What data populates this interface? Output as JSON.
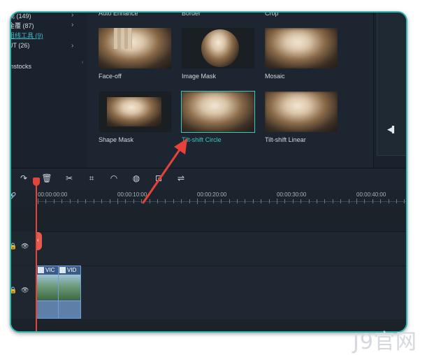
{
  "sidebar": {
    "items": [
      {
        "label": "视 (149)",
        "chevron": true
      },
      {
        "label": "金覆 (87)",
        "chevron": true
      },
      {
        "label": "组线工具 (9)",
        "chevron": false,
        "active": true
      },
      {
        "label": "UT (26)",
        "chevron": true
      },
      {
        "label": "mstocks",
        "chevron": false
      }
    ],
    "chevron_glyph": "›",
    "collapse_glyph": "‹"
  },
  "effects": {
    "top_row_labels": [
      "Auto Enhance",
      "Border",
      "Crop"
    ],
    "items": [
      {
        "label": "Face-off",
        "selected": false,
        "effect": "face-off"
      },
      {
        "label": "Image Mask",
        "selected": false,
        "effect": "circle"
      },
      {
        "label": "Mosaic",
        "selected": false,
        "effect": "mosaic"
      },
      {
        "label": "Shape Mask",
        "selected": false,
        "effect": "rect"
      },
      {
        "label": "Tilt-shift Circle",
        "selected": true,
        "effect": "tilt-circle"
      },
      {
        "label": "Tilt-shift Linear",
        "selected": false,
        "effect": "tilt-linear"
      }
    ]
  },
  "preview": {
    "controls_glyph": "◀▌"
  },
  "toolbar": {
    "tools": [
      {
        "name": "redo-icon",
        "glyph": "↷"
      },
      {
        "name": "delete-icon",
        "glyph": "🗑"
      },
      {
        "name": "cut-icon",
        "glyph": "✂"
      },
      {
        "name": "crop-icon",
        "glyph": "⌗"
      },
      {
        "name": "speed-icon",
        "glyph": "◠"
      },
      {
        "name": "color-icon",
        "glyph": "◍"
      },
      {
        "name": "green-screen-icon",
        "glyph": "⊡"
      },
      {
        "name": "adjust-icon",
        "glyph": "⇌"
      }
    ]
  },
  "timeline": {
    "timecodes": [
      "00:00:00:00",
      "00:00:10:00",
      "00:00:20:00",
      "00:00:30:00",
      "00:00:40:00"
    ],
    "clips": [
      {
        "label": "VIC"
      },
      {
        "label": "VID"
      }
    ],
    "link_glyph": "🔗",
    "lock_glyph": "🔒",
    "eye_glyph": "👁",
    "red_tab_glyph": "‹"
  },
  "colors": {
    "accent": "#3ec7bc",
    "playhead": "#e2463b",
    "annotation_arrow": "#e8403a",
    "frame_border": "#2fb8b0"
  },
  "watermark": "J9官网"
}
